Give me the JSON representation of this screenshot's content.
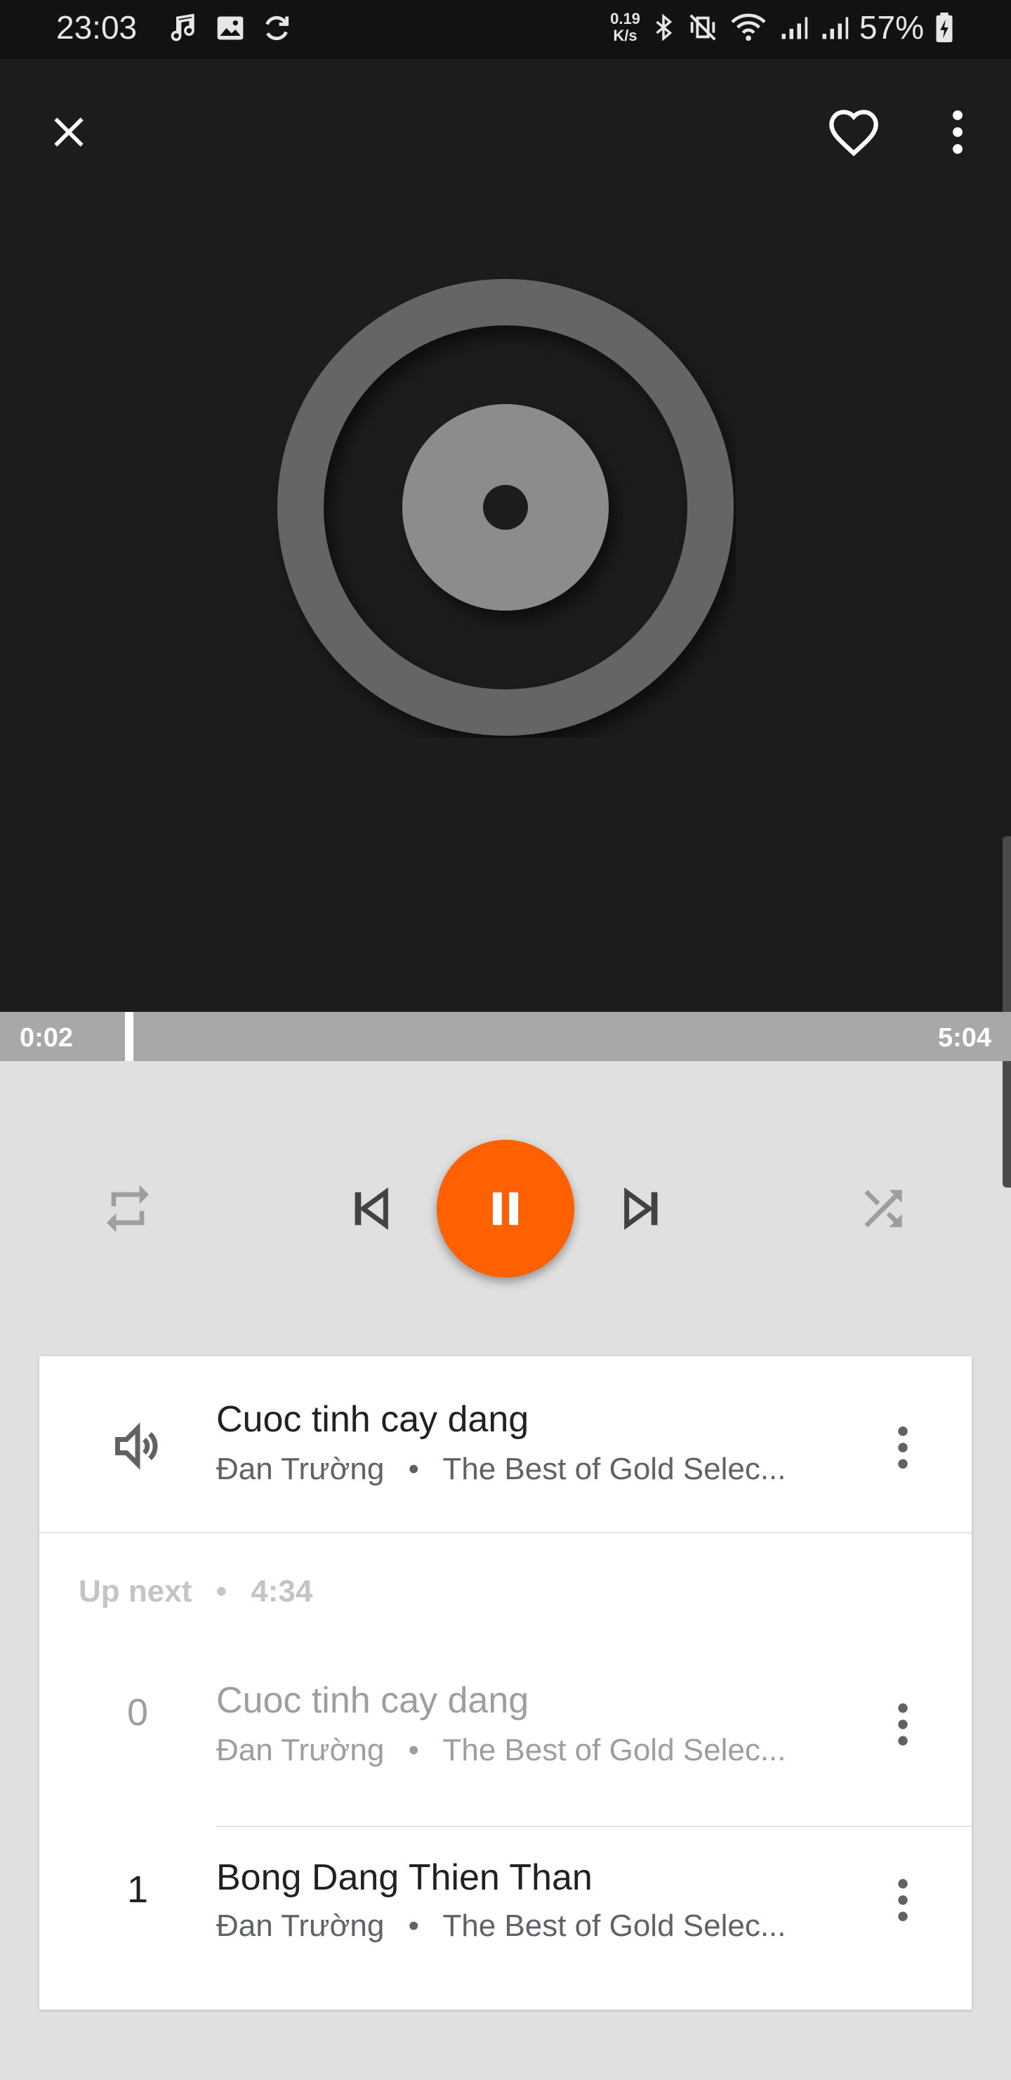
{
  "status_bar": {
    "time": "23:03",
    "net_speed_value": "0.19",
    "net_speed_unit": "K/s",
    "battery": "57%",
    "left_icons": [
      "music-note-icon",
      "image-icon",
      "sync-icon"
    ],
    "right_icons": [
      "bluetooth-icon",
      "vibrate-off-icon",
      "wifi-icon",
      "signal-icon",
      "signal-icon",
      "battery-charging-icon"
    ]
  },
  "player": {
    "accent_color": "#ff6000",
    "elapsed": "0:02",
    "duration": "5:04",
    "progress_fraction": 0.0066
  },
  "now_playing": {
    "title": "Cuoc tinh cay dang",
    "artist": "Đan Trường",
    "separator": "•",
    "album": "The Best of Gold Selec..."
  },
  "up_next": {
    "label": "Up next",
    "separator": "•",
    "total_time": "4:34"
  },
  "queue": [
    {
      "index": "0",
      "title": "Cuoc tinh cay dang",
      "artist": "Đan Trường",
      "separator": "•",
      "album": "The Best of Gold Selec..."
    },
    {
      "index": "1",
      "title": "Bong Dang Thien Than",
      "artist": "Đan Trường",
      "separator": "•",
      "album": "The Best of Gold Selec..."
    }
  ]
}
